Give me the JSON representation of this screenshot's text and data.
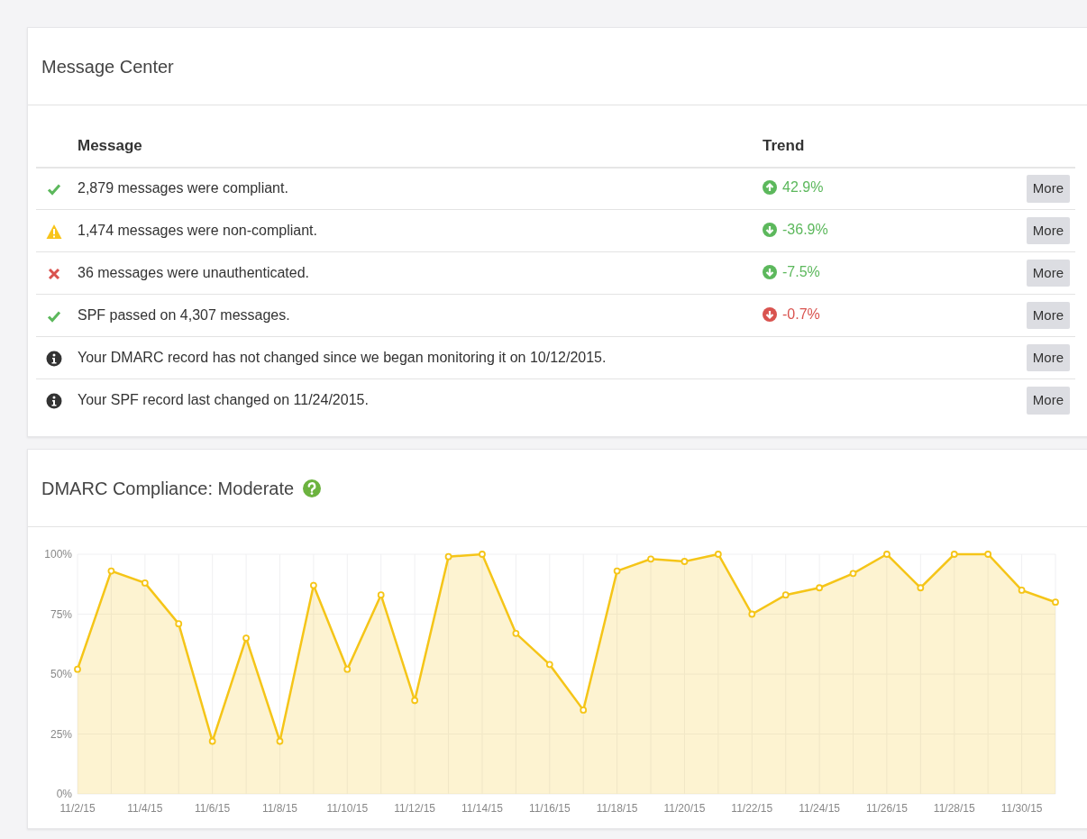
{
  "message_center": {
    "title": "Message Center",
    "columns": [
      "Message",
      "Trend"
    ],
    "rows": [
      {
        "kind": "success",
        "message": "2,879 messages were compliant.",
        "trend": {
          "text": "42.9%",
          "kind": "up",
          "color": "#5cb85c"
        },
        "button": "More"
      },
      {
        "kind": "warning",
        "message": "1,474 messages were non-compliant.",
        "trend": {
          "text": "-36.9%",
          "kind": "down",
          "color": "#5cb85c"
        },
        "button": "More"
      },
      {
        "kind": "error",
        "message": "36 messages were unauthenticated.",
        "trend": {
          "text": "-7.5%",
          "kind": "down",
          "color": "#5cb85c"
        },
        "button": "More"
      },
      {
        "kind": "success",
        "message": "SPF passed on 4,307 messages.",
        "trend": {
          "text": "-0.7%",
          "kind": "down",
          "color": "#d9534f"
        },
        "button": "More"
      },
      {
        "kind": "info",
        "message": "Your DMARC record has not changed since we began monitoring it on 10/12/2015.",
        "button": "More"
      },
      {
        "kind": "info",
        "message": "Your SPF record last changed on 11/24/2015.",
        "button": "More"
      }
    ]
  },
  "compliance": {
    "title": "DMARC Compliance: Moderate",
    "chart_data": {
      "type": "area",
      "categories": [
        "11/2/15",
        null,
        "11/4/15",
        null,
        "11/6/15",
        null,
        "11/8/15",
        null,
        "11/10/15",
        null,
        "11/12/15",
        null,
        "11/14/15",
        null,
        "11/16/15",
        null,
        "11/18/15",
        null,
        "11/20/15",
        null,
        "11/22/15",
        null,
        "11/24/15",
        null,
        "11/26/15",
        null,
        "11/28/15",
        null,
        "11/30/15",
        null
      ],
      "series": [
        {
          "color": "#f5c518",
          "values": [
            52,
            93,
            88,
            71,
            22,
            65,
            22,
            87,
            52,
            83,
            39,
            99,
            100,
            67,
            54,
            35,
            93,
            98,
            97,
            100,
            75,
            83,
            86,
            92,
            100,
            86,
            100,
            100,
            85,
            80
          ]
        }
      ],
      "ylim": [
        0,
        100
      ],
      "grid": true,
      "yticks": [
        {
          "value": 0,
          "label": "0%"
        },
        {
          "value": 25,
          "label": "25%"
        },
        {
          "value": 50,
          "label": "50%"
        },
        {
          "value": 75,
          "label": "75%"
        },
        {
          "value": 100,
          "label": "100%"
        }
      ]
    }
  }
}
